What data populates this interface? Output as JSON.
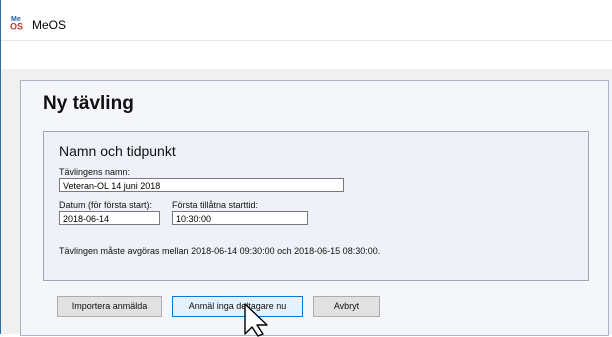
{
  "window": {
    "title": "MeOS",
    "logo_text_top": "Me",
    "logo_text_bottom": "OS"
  },
  "panel": {
    "title": "Ny tävling",
    "group": {
      "title": "Namn och tidpunkt",
      "name_label": "Tävlingens namn:",
      "name_value": "Veteran-OL 14 juni 2018",
      "date_label": "Datum (för första start):",
      "date_value": "2018-06-14",
      "time_label": "Första tillåtna starttid:",
      "time_value": "10:30:00",
      "info_text": "Tävlingen måste avgöras mellan 2018-06-14 09:30:00 och 2018-06-15 08:30:00."
    },
    "buttons": {
      "import": "Importera anmälda",
      "register_none": "Anmäl inga deltagare nu",
      "cancel": "Avbryt"
    }
  },
  "colors": {
    "accent": "#0078d7",
    "logo_top": "#1a5fb4",
    "logo_bottom": "#c0392b"
  }
}
